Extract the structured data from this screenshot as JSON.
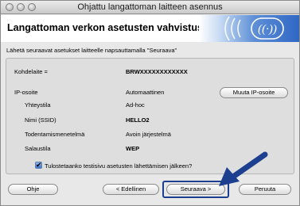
{
  "window": {
    "title": "Ohjattu langattoman laitteen asennus"
  },
  "banner": {
    "title": "Langattoman verkon asetusten vahvistus"
  },
  "instruction": "Lähetä seuraavat asetukset laitteelle napsauttamalla \"Seuraava\"",
  "settings": {
    "target_label": "Kohdelaite =",
    "target_value": "BRWXXXXXXXXXXXX",
    "ip_label": "IP-osoite",
    "ip_value": "Automaattinen",
    "change_ip_button": "Muuta IP-osoite",
    "mode_label": "Yhteystila",
    "mode_value": "Ad-hoc",
    "ssid_label": "Nimi (SSID)",
    "ssid_value": "HELLO2",
    "auth_label": "Todentamismenetelmä",
    "auth_value": "Avoin järjestelmä",
    "enc_label": "Salaustila",
    "enc_value": "WEP"
  },
  "checkbox": {
    "label": "Tulostetaanko testisivu asetusten lähettämisen jälkeen?",
    "checked": true
  },
  "buttons": {
    "help": "Ohje",
    "back": "< Edellinen",
    "next": "Seuraava >",
    "cancel": "Peruuta"
  },
  "colors": {
    "arrow": "#1d3f8f",
    "banner_blue": "#2f67c4"
  }
}
